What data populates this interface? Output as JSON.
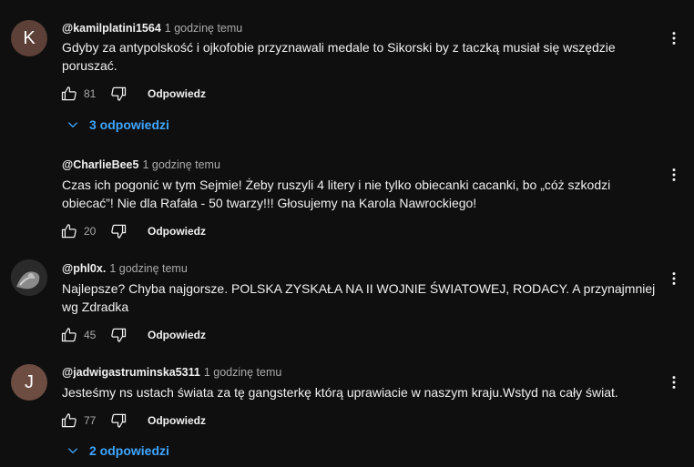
{
  "comments": [
    {
      "avatar_letter": "K",
      "avatar_color": "#5d4037",
      "author": "@kamilplatini1564",
      "time": "1 godzinę temu",
      "text": "Gdyby za antypolskość i ojkofobie przyznawali medale to Sikorski by z taczką musiał się wszędzie poruszać.",
      "likes": "81",
      "reply_label": "Odpowiedz",
      "replies_label": "3 odpowiedzi"
    },
    {
      "avatar_letter": "",
      "avatar_color": "",
      "author": "@CharlieBee5",
      "time": "1 godzinę temu",
      "text": "Czas ich pogonić w tym Sejmie! Żeby ruszyli 4 litery i nie tylko obiecanki cacanki, bo „cóż szkodzi obiecać”! Nie dla Rafała - 50 twarzy!!! Głosujemy na Karola Nawrockiego!",
      "likes": "20",
      "reply_label": "Odpowiedz"
    },
    {
      "avatar_letter": "",
      "avatar_color": "#3a3a3a",
      "author": "@phl0x.",
      "time": "1 godzinę temu",
      "text": "Najlepsze? Chyba najgorsze. POLSKA ZYSKAŁA NA II WOJNIE ŚWIATOWEJ, RODACY. A przynajmniej wg Zdradka",
      "likes": "45",
      "reply_label": "Odpowiedz"
    },
    {
      "avatar_letter": "J",
      "avatar_color": "#6d4c41",
      "author": "@jadwigastruminska5311",
      "time": "1 godzinę temu",
      "text": "Jesteśmy ns ustach świata za tę gangsterkę którą uprawiacie w naszym kraju.Wstyd na cały świat.",
      "likes": "77",
      "reply_label": "Odpowiedz",
      "replies_label": "2 odpowiedzi"
    }
  ],
  "icons": {
    "like": "thumb-up-icon",
    "dislike": "thumb-down-icon",
    "more": "more-vert-icon",
    "expand": "chevron-down-icon"
  },
  "colors": {
    "background": "#0f0f0f",
    "link": "#3ea6ff",
    "secondary_text": "#aaaaaa"
  }
}
